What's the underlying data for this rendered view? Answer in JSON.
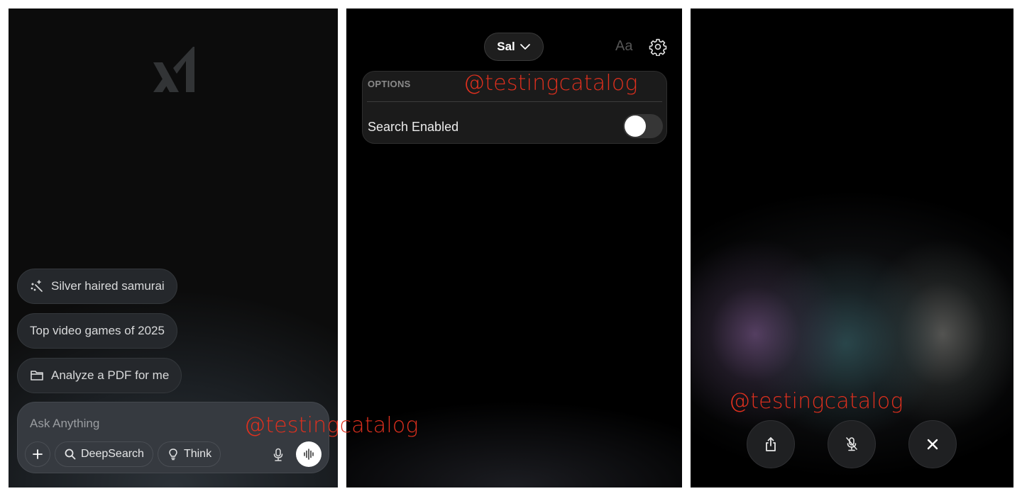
{
  "panel_home": {
    "logo": "xai-logo",
    "suggestions": [
      {
        "label": "Silver haired samurai",
        "icon": "magic-wand-icon"
      },
      {
        "label": "Top video games of 2025",
        "icon": null
      },
      {
        "label": "Analyze a PDF for me",
        "icon": "folder-icon"
      }
    ],
    "composer": {
      "placeholder": "Ask Anything",
      "attach_icon": "plus-icon",
      "deepsearch_label": "DeepSearch",
      "deepsearch_icon": "search-icon",
      "think_label": "Think",
      "think_icon": "lightbulb-icon",
      "mic_icon": "microphone-icon",
      "voice_icon": "waveform-icon"
    }
  },
  "panel_settings": {
    "model_selector": {
      "label": "Sal",
      "icon": "chevron-down-icon"
    },
    "text_size_label": "Aa",
    "settings_icon": "gear-icon",
    "options": {
      "title": "OPTIONS",
      "items": [
        {
          "label": "Search Enabled",
          "enabled": false
        }
      ]
    }
  },
  "panel_voice": {
    "controls": [
      {
        "name": "share",
        "icon": "share-icon"
      },
      {
        "name": "mute",
        "icon": "microphone-off-icon"
      },
      {
        "name": "close",
        "icon": "close-icon"
      }
    ]
  },
  "watermark": "@testingcatalog",
  "colors": {
    "watermark": "#e0301e",
    "panel_bg": "#0c0c0c",
    "chip_bg": "#25282c",
    "toggle_off": "#363636"
  }
}
